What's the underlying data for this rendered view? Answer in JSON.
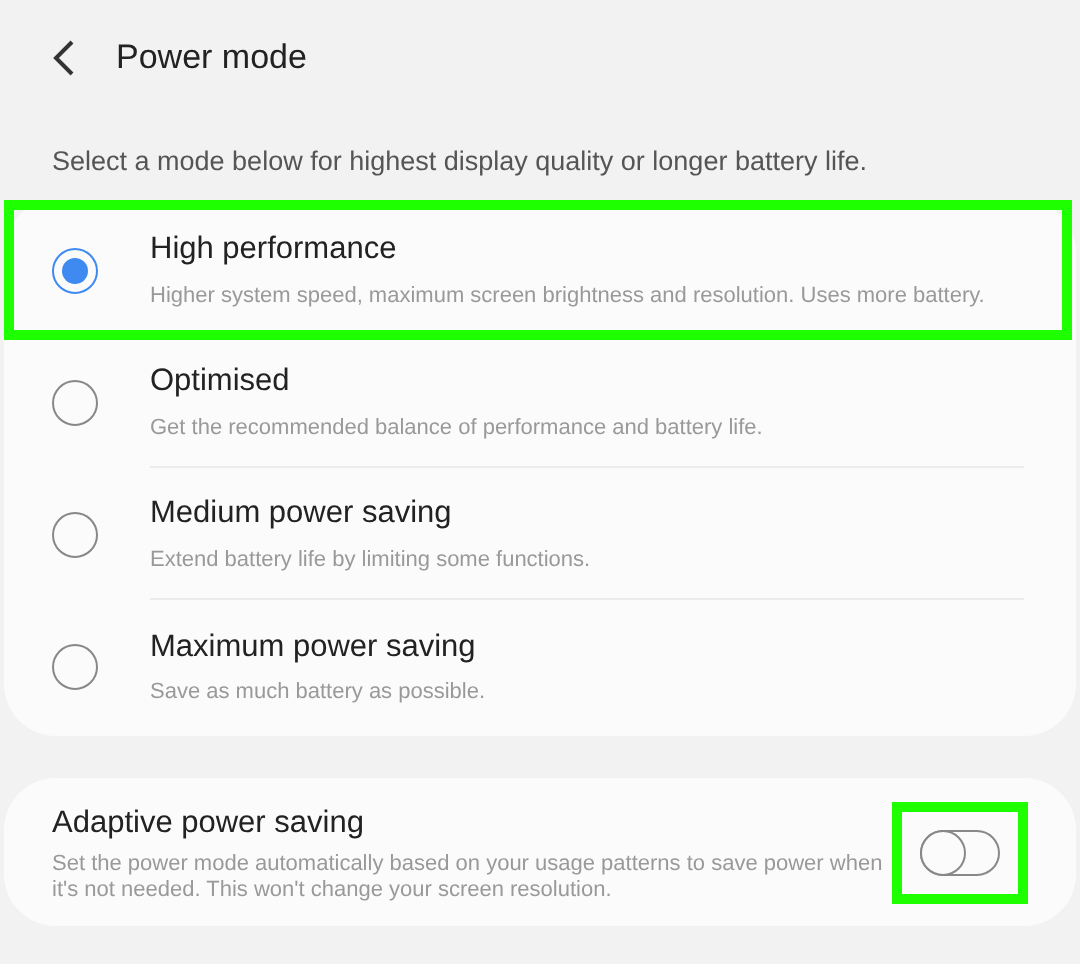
{
  "header": {
    "title": "Power mode"
  },
  "intro": "Select a mode below for highest display quality or longer battery life.",
  "modes": [
    {
      "title": "High performance",
      "description": "Higher system speed, maximum screen brightness and resolution. Uses more battery.",
      "selected": true,
      "highlighted": true
    },
    {
      "title": "Optimised",
      "description": "Get the recommended balance of performance and battery life.",
      "selected": false,
      "highlighted": false
    },
    {
      "title": "Medium power saving",
      "description": "Extend battery life by limiting some functions.",
      "selected": false,
      "highlighted": false
    },
    {
      "title": "Maximum power saving",
      "description": "Save as much battery as possible.",
      "selected": false,
      "highlighted": false
    }
  ],
  "adaptive": {
    "title": "Adaptive power saving",
    "description": "Set the power mode automatically based on your usage patterns to save power when it's not needed. This won't change your screen resolution.",
    "on": false,
    "highlighted": true
  }
}
